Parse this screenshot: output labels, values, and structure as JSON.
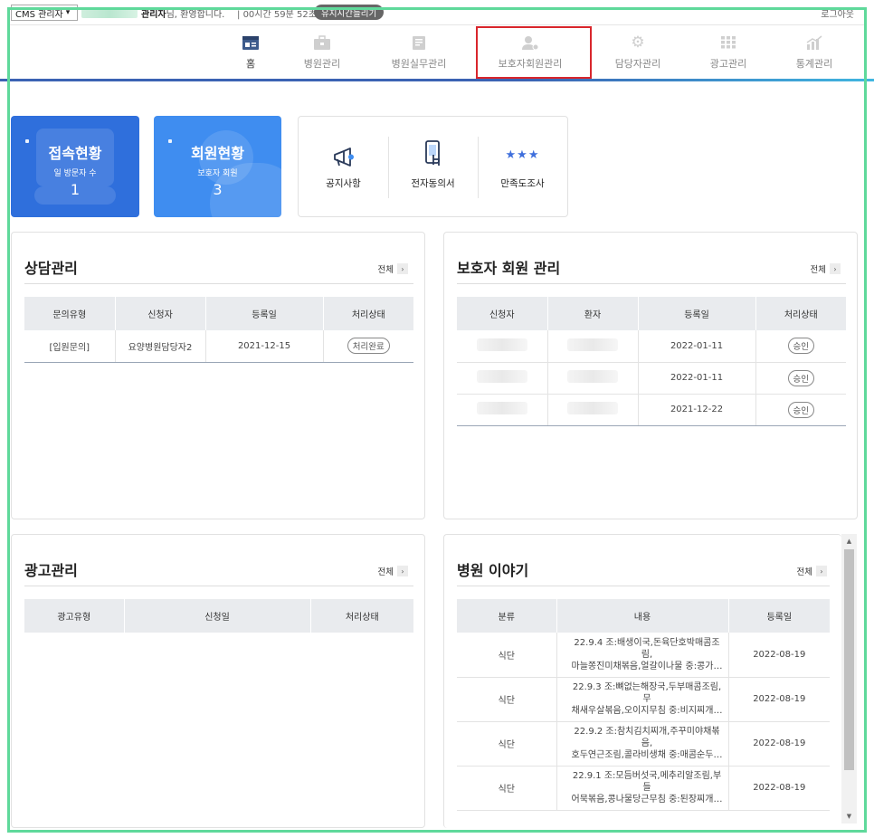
{
  "topbar": {
    "role_select": "CMS 관리자",
    "welcome_name": "관리자",
    "welcome_suffix": "님, 환영합니다.",
    "timer": "00시간 59분 52초",
    "extend_button": "유지시간늘리기",
    "logout": "로그아웃"
  },
  "nav": {
    "items": [
      {
        "label": "홈",
        "icon": "home-icon"
      },
      {
        "label": "병원관리",
        "icon": "briefcase-icon"
      },
      {
        "label": "병원실무관리",
        "icon": "clipboard-icon"
      },
      {
        "label": "보호자회원관리",
        "icon": "user-gear-icon"
      },
      {
        "label": "담당자관리",
        "icon": "gear-icon"
      },
      {
        "label": "광고관리",
        "icon": "grid-icon"
      },
      {
        "label": "통계관리",
        "icon": "chart-icon"
      }
    ],
    "active_color": "#3d5b8c",
    "highlight_color": "#d9262c"
  },
  "stats": {
    "access": {
      "title": "접속현황",
      "sub": "일 방문자 수",
      "value": "1",
      "color": "#2f6fdc"
    },
    "members": {
      "title": "회원현황",
      "sub": "보호자 회원",
      "value": "3",
      "color": "#3f8df0"
    }
  },
  "quick": {
    "notice": "공지사항",
    "consent": "전자동의서",
    "survey": "만족도조사"
  },
  "consult": {
    "title": "상담관리",
    "more": "전체",
    "headers": [
      "문의유형",
      "신청자",
      "등록일",
      "처리상태"
    ],
    "rows": [
      {
        "type": "[입원문의]",
        "applicant": "요양병원담당자2",
        "date": "2021-12-15",
        "status": "처리완료"
      }
    ]
  },
  "guardian": {
    "title": "보호자 회원 관리",
    "more": "전체",
    "headers": [
      "신청자",
      "환자",
      "등록일",
      "처리상태"
    ],
    "rows": [
      {
        "date": "2022-01-11",
        "status": "승인"
      },
      {
        "date": "2022-01-11",
        "status": "승인"
      },
      {
        "date": "2021-12-22",
        "status": "승인"
      }
    ]
  },
  "ads": {
    "title": "광고관리",
    "more": "전체",
    "headers": [
      "광고유형",
      "신청일",
      "처리상태"
    ]
  },
  "story": {
    "title": "병원 이야기",
    "more": "전체",
    "headers": [
      "분류",
      "내용",
      "등록일"
    ],
    "rows": [
      {
        "category": "식단",
        "line1": "22.9.4 조:배생이국,돈육단호박매콤조림,",
        "line2": "마늘쫑진미채볶음,얼갈이나물 중:콩가…",
        "date": "2022-08-19"
      },
      {
        "category": "식단",
        "line1": "22.9.3 조:뼈없는해장국,두부매콤조림,무",
        "line2": "채새우살볶음,오이지무침 중:비지찌개…",
        "date": "2022-08-19"
      },
      {
        "category": "식단",
        "line1": "22.9.2 조:참치김치찌개,주꾸미야채볶음,",
        "line2": "호두연근조림,콜라비생채 중:매콤순두…",
        "date": "2022-08-19"
      },
      {
        "category": "식단",
        "line1": "22.9.1 조:모듬버섯국,메추리알조림,부들",
        "line2": "어묵볶음,콩나물당근무침 중:된장찌개…",
        "date": "2022-08-19"
      }
    ]
  }
}
